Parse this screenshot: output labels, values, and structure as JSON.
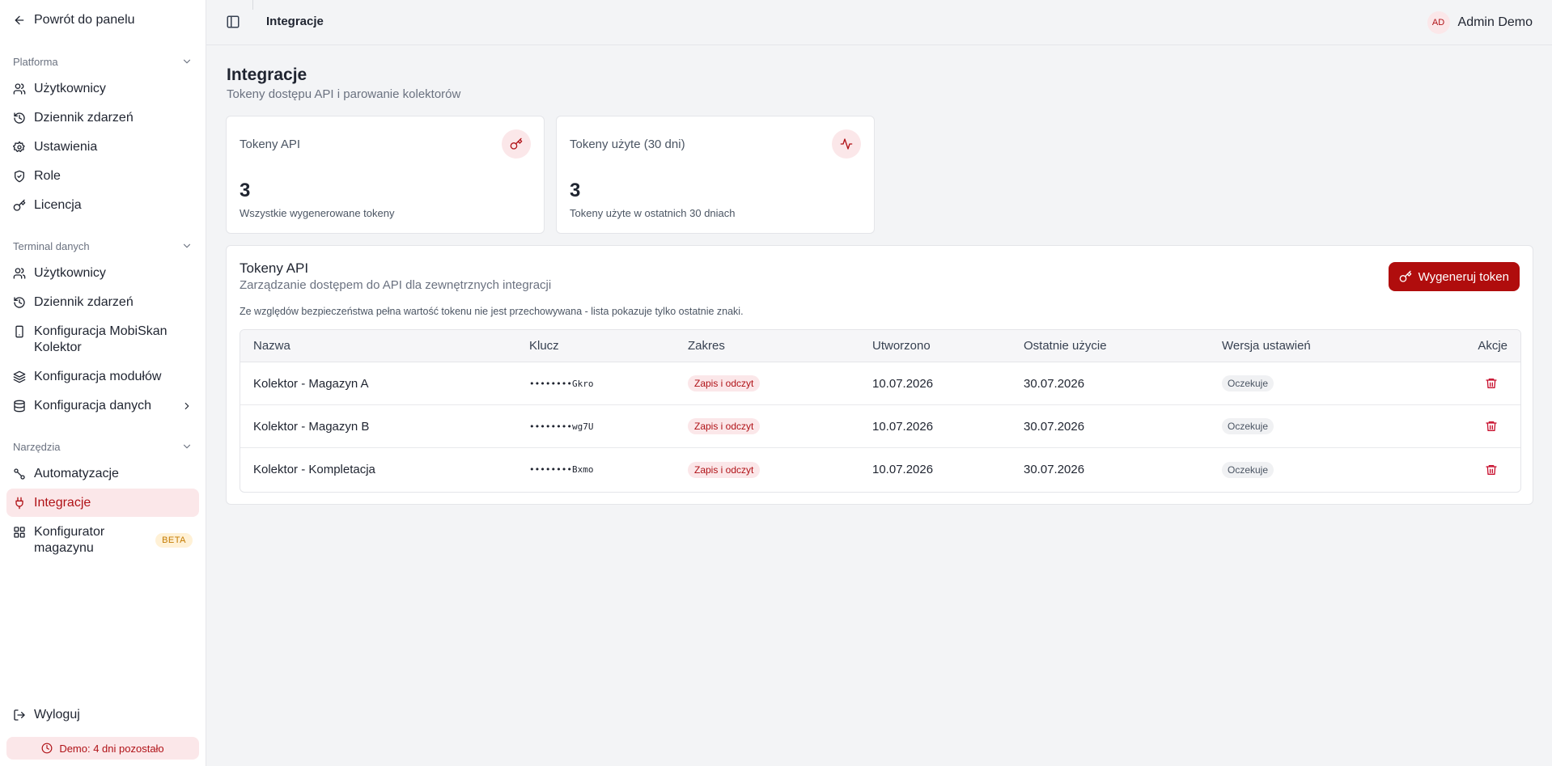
{
  "sidebar": {
    "back_label": "Powrót do panelu",
    "sections": [
      {
        "title": "Platforma",
        "items": [
          "Użytkownicy",
          "Dziennik zdarzeń",
          "Ustawienia",
          "Role",
          "Licencja"
        ]
      },
      {
        "title": "Terminal danych",
        "items": [
          "Użytkownicy",
          "Dziennik zdarzeń",
          "Konfiguracja MobiSkan Kolektor",
          "Konfiguracja modułów",
          "Konfiguracja danych"
        ]
      },
      {
        "title": "Narzędzia",
        "items": [
          "Automatyzacje",
          "Integracje",
          "Konfigurator magazynu"
        ]
      }
    ],
    "beta_label": "BETA",
    "logout_label": "Wyloguj",
    "demo_label": "Demo: 4 dni pozostało"
  },
  "topbar": {
    "title": "Integracje",
    "user_initials": "AD",
    "user_name": "Admin Demo"
  },
  "page": {
    "title": "Integracje",
    "subtitle": "Tokeny dostępu API i parowanie kolektorów"
  },
  "stats": [
    {
      "title": "Tokeny API",
      "value": "3",
      "desc": "Wszystkie wygenerowane tokeny",
      "icon": "key-icon"
    },
    {
      "title": "Tokeny użyte (30 dni)",
      "value": "3",
      "desc": "Tokeny użyte w ostatnich 30 dniach",
      "icon": "activity-icon"
    }
  ],
  "panel": {
    "title": "Tokeny API",
    "subtitle": "Zarządzanie dostępem do API dla zewnętrznych integracji",
    "note": "Ze względów bezpieczeństwa pełna wartość tokenu nie jest przechowywana - lista pokazuje tylko ostatnie znaki.",
    "generate_label": "Wygeneruj token",
    "columns": [
      "Nazwa",
      "Klucz",
      "Zakres",
      "Utworzono",
      "Ostatnie użycie",
      "Wersja ustawień",
      "Akcje"
    ],
    "rows": [
      {
        "name": "Kolektor - Magazyn A",
        "key": "••••••••Gkro",
        "scope": "Zapis i odczyt",
        "created": "10.07.2026",
        "last_used": "30.07.2026",
        "version": "Oczekuje"
      },
      {
        "name": "Kolektor - Magazyn B",
        "key": "••••••••wg7U",
        "scope": "Zapis i odczyt",
        "created": "10.07.2026",
        "last_used": "30.07.2026",
        "version": "Oczekuje"
      },
      {
        "name": "Kolektor - Kompletacja",
        "key": "••••••••Bxmo",
        "scope": "Zapis i odczyt",
        "created": "10.07.2026",
        "last_used": "30.07.2026",
        "version": "Oczekuje"
      }
    ]
  },
  "colors": {
    "accent": "#b00d0d",
    "accent_soft": "#fbe7e9",
    "beta": "#c47a00"
  }
}
